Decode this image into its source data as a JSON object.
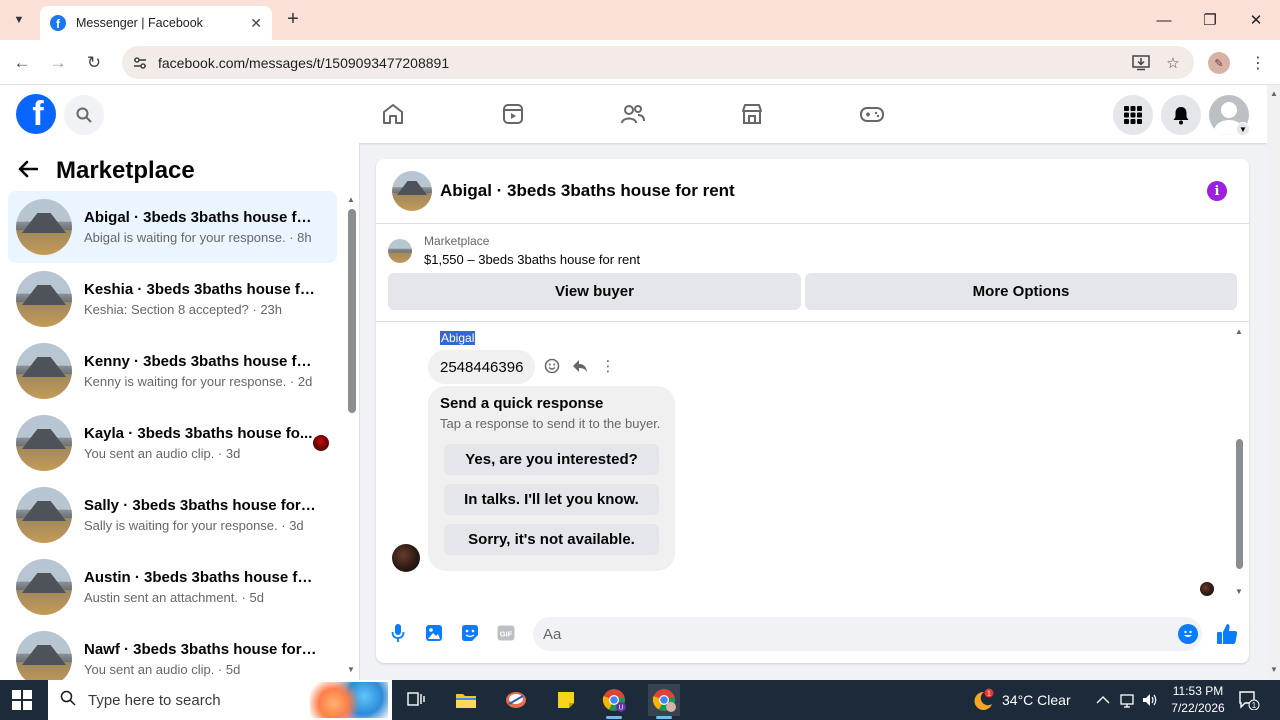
{
  "browser": {
    "tab_title": "Messenger | Facebook",
    "url": "facebook.com/messages/t/1509093477208891",
    "new_tab_label": "+",
    "minimize": "—",
    "maximize": "❐",
    "close": "✕"
  },
  "left_panel": {
    "title": "Marketplace",
    "conversations": [
      {
        "name": "Abigal · 3beds 3baths house for ...",
        "sub": "Abigal is waiting for your response. · 8h",
        "active": true
      },
      {
        "name": "Keshia · 3beds 3baths house for ...",
        "sub": "Keshia: Section 8 accepted? · 23h"
      },
      {
        "name": "Kenny · 3beds 3baths house for ...",
        "sub": "Kenny is waiting for your response. · 2d"
      },
      {
        "name": "Kayla · 3beds 3baths house fo...",
        "sub": "You sent an audio clip. · 3d"
      },
      {
        "name": "Sally · 3beds 3baths house for re...",
        "sub": "Sally is waiting for your response. · 3d"
      },
      {
        "name": "Austin · 3beds 3baths house for ...",
        "sub": "Austin sent an attachment. · 5d"
      },
      {
        "name": "Nawf · 3beds 3baths house for r...",
        "sub": "You sent an audio clip. · 5d"
      }
    ]
  },
  "chat": {
    "title": "Abigal · 3beds 3baths house for rent",
    "listing_source": "Marketplace",
    "listing_title": "$1,550 – 3beds 3baths house for rent",
    "view_buyer_label": "View buyer",
    "more_options_label": "More Options",
    "sender_name": "Abigal",
    "phone_message": "2548446396",
    "quick_title": "Send a quick response",
    "quick_sub": "Tap a response to send it to the buyer.",
    "quick_responses": [
      "Yes, are you interested?",
      "In talks. I'll let you know.",
      "Sorry, it's not available."
    ],
    "composer_placeholder": "Aa"
  },
  "taskbar": {
    "search_placeholder": "Type here to search",
    "weather": "34°C  Clear",
    "weather_badge": "1",
    "time": "11:53 PM",
    "date": "7/22/2026",
    "notif_count": "1"
  },
  "colors": {
    "fb_blue": "#0866ff",
    "messenger_blue": "#0a7cff",
    "info_purple": "#9b20e0",
    "active_row": "#ebf5ff"
  }
}
